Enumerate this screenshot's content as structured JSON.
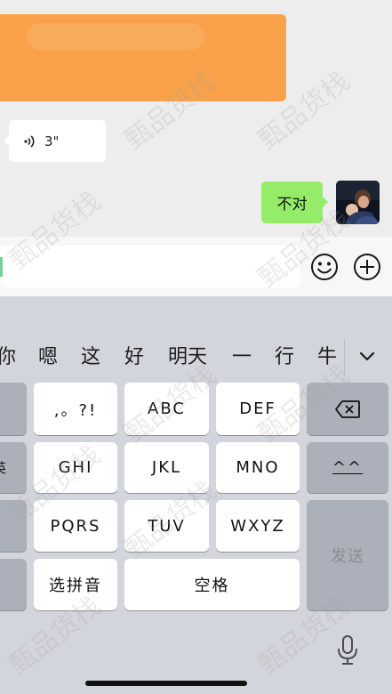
{
  "chat": {
    "redacted_color": "#f9a24a",
    "voice_message": {
      "duration": "3\"",
      "icon": "voice-wave-icon"
    },
    "sent_message": {
      "text": "不对",
      "bubble_color": "#95ec69"
    },
    "avatar": {
      "icon": "user-avatar"
    }
  },
  "input_bar": {
    "text_value": "",
    "caret_color": "#6fd39a",
    "emoji_icon": "smiley-icon",
    "more_icon": "plus-circle-icon"
  },
  "keyboard": {
    "candidates": [
      "你",
      "嗯",
      "这",
      "好",
      "明天",
      "一",
      "行",
      "牛"
    ],
    "candidates_toggle_icon": "chevron-down-icon",
    "keys": {
      "punct": ",。?!",
      "abc": "ABC",
      "def": "DEF",
      "ghi": "GHI",
      "jkl": "JKL",
      "mno": "MNO",
      "pqrs": "PQRS",
      "tuv": "TUV",
      "wxyz": "WXYZ",
      "pinyin": "选拼音",
      "space": "空格",
      "emoticon": "^^",
      "send": "发送",
      "left_partial_1": "",
      "left_partial_2": "英",
      "left_partial_3": "",
      "left_partial_4": ""
    },
    "backspace_icon": "backspace-icon",
    "mic_icon": "microphone-icon"
  },
  "watermark": {
    "text": "甄品货栈"
  }
}
